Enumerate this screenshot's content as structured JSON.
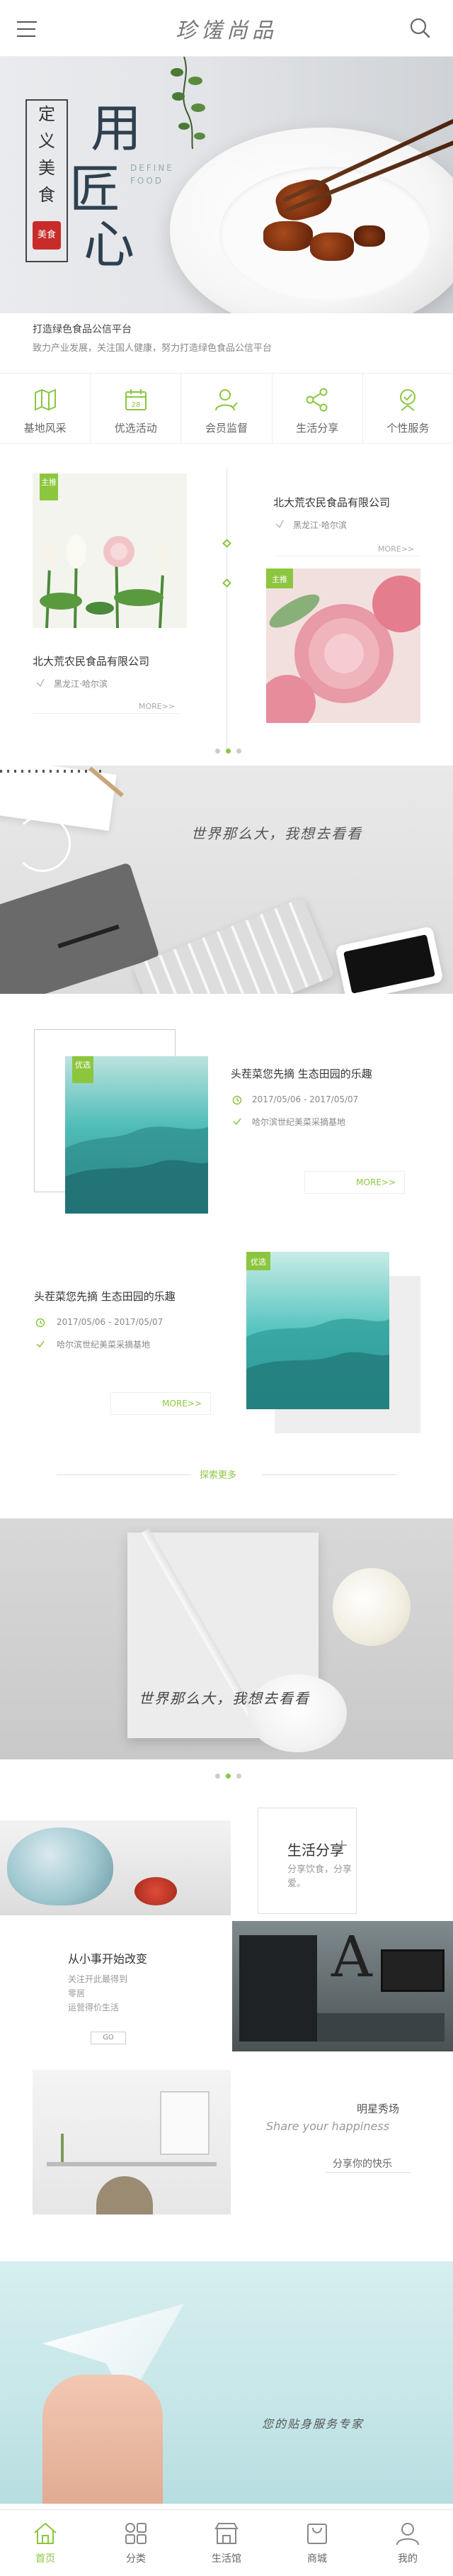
{
  "header": {
    "logo": "珍馐尚品"
  },
  "hero": {
    "stamp_chars": [
      "定",
      "义",
      "美",
      "食"
    ],
    "seal": "美食",
    "big_chars": [
      "用",
      "匠",
      "心"
    ],
    "en": [
      "DEFINE",
      "FOOD"
    ]
  },
  "intro": {
    "title": "打造绿色食品公信平台",
    "desc": "致力产业发展，关注国人健康，努力打造绿色食品公信平台"
  },
  "nav": [
    {
      "label": "基地风采",
      "icon": "map-icon"
    },
    {
      "label": "优选活动",
      "icon": "calendar-icon"
    },
    {
      "label": "会员监督",
      "icon": "user-check-icon"
    },
    {
      "label": "生活分享",
      "icon": "share-icon"
    },
    {
      "label": "个性服务",
      "icon": "service-icon"
    }
  ],
  "products": [
    {
      "tag": "主推",
      "company": "北大荒农民食品有限公司",
      "location": "黑龙江·哈尔滨",
      "more": "MORE>>"
    },
    {
      "tag": "主推",
      "company": "北大荒农民食品有限公司",
      "location": "黑龙江·哈尔滨",
      "more": "MORE>>"
    }
  ],
  "desk_banner": {
    "slogan": "世界那么大，我想去看看"
  },
  "activities": [
    {
      "tag": "优选",
      "title": "头茬菜您先摘  生态田园的乐趣",
      "date": "2017/05/06 - 2017/05/07",
      "place": "哈尔滨世纪美菜采摘基地",
      "more": "MORE>>"
    },
    {
      "tag": "优选",
      "title": "头茬菜您先摘  生态田园的乐趣",
      "date": "2017/05/06 - 2017/05/07",
      "place": "哈尔滨世纪美菜采摘基地",
      "more": "MORE>>"
    }
  ],
  "explore_more": "探索更多",
  "banner2": {
    "slogan": "世界那么大，我想去看看"
  },
  "life": {
    "share_title": "生活分享",
    "share_sub": [
      "分享饮食，分享",
      "爱。"
    ],
    "small_change_title": "从小事开始改变",
    "small_change_sub": [
      "关注开此最得到",
      "零居",
      "运营得价生活"
    ],
    "small_change_btn": "GO",
    "star_title": "明星秀场",
    "star_en": "Share your happiness",
    "star_link": "分享你的快乐"
  },
  "service_banner": {
    "text": "您的贴身服务专家"
  },
  "tabbar": [
    {
      "label": "首页",
      "icon": "home-icon",
      "active": true
    },
    {
      "label": "分类",
      "icon": "grid-icon",
      "active": false
    },
    {
      "label": "生活馆",
      "icon": "shop-icon",
      "active": false
    },
    {
      "label": "商城",
      "icon": "bag-icon",
      "active": false
    },
    {
      "label": "我的",
      "icon": "profile-icon",
      "active": false
    }
  ],
  "colors": {
    "accent": "#8cc63f",
    "text": "#333333",
    "muted": "#888888"
  }
}
